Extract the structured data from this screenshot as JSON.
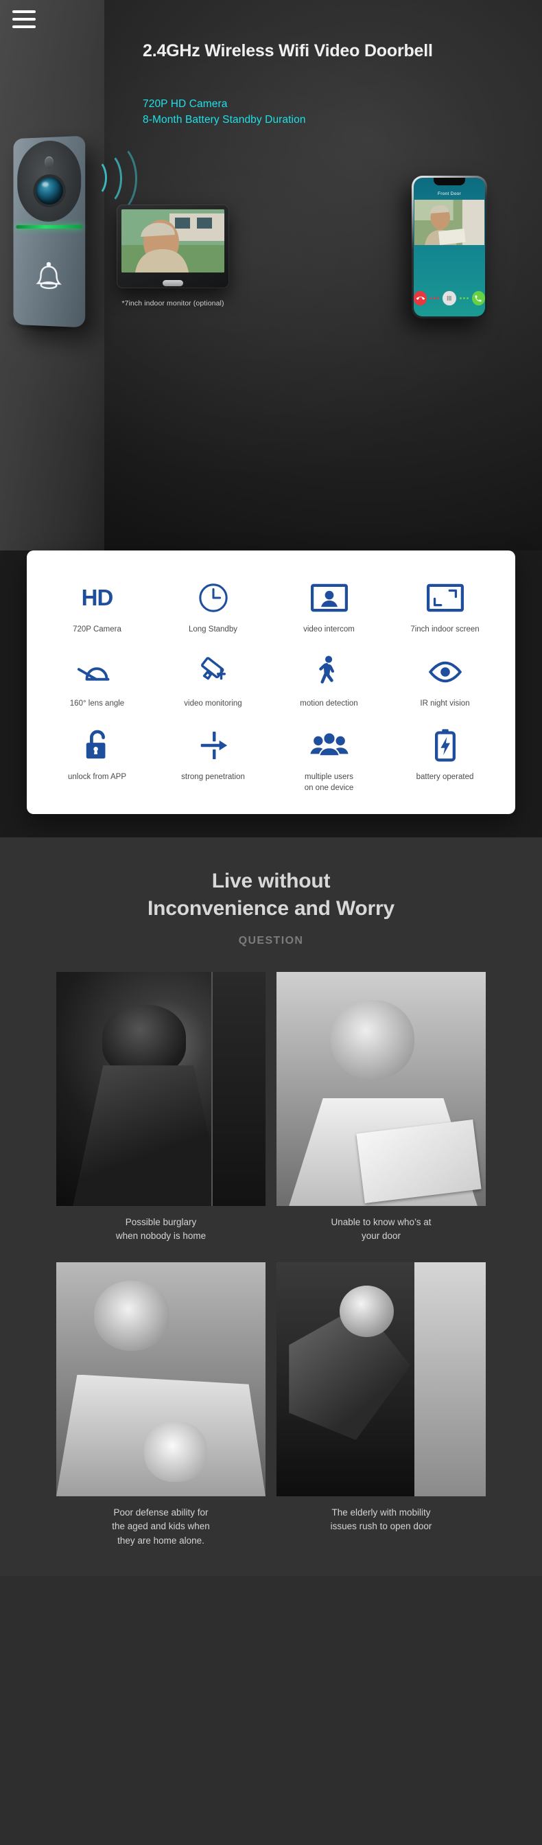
{
  "hero": {
    "menu_icon": "hamburger-menu-icon",
    "title": "2.4GHz Wireless\nWifi Video Doorbell",
    "highlight_1": "720P HD Camera",
    "highlight_2": "8-Month Battery Standby Duration",
    "monitor_caption": "*7inch indoor monitor (optional)",
    "phone": {
      "screen_title": "Front Door",
      "decline_icon": "phone-decline-icon",
      "mute_icon": "speaker-mute-icon",
      "answer_icon": "phone-answer-icon"
    },
    "colors": {
      "accent_cyan": "#1fe0e8",
      "led_green": "#27e06a",
      "decline_red": "#e8383f",
      "answer_green": "#66d143"
    }
  },
  "features": {
    "accent_blue": "#1f4f9c",
    "items": [
      {
        "icon": "hd-text-icon",
        "label": "720P Camera"
      },
      {
        "icon": "clock-icon",
        "label": "Long Standby"
      },
      {
        "icon": "person-in-frame-icon",
        "label": "video intercom"
      },
      {
        "icon": "screen-corners-icon",
        "label": "7inch indoor screen"
      },
      {
        "icon": "lens-angle-icon",
        "label": "160° lens angle"
      },
      {
        "icon": "cctv-camera-icon",
        "label": "video monitoring"
      },
      {
        "icon": "walking-person-icon",
        "label": "motion detection"
      },
      {
        "icon": "eye-icon",
        "label": "IR night vision"
      },
      {
        "icon": "open-padlock-icon",
        "label": "unlock from APP"
      },
      {
        "icon": "arrow-through-wall-icon",
        "label": "strong penetration"
      },
      {
        "icon": "group-users-icon",
        "label": "multiple users\non one device"
      },
      {
        "icon": "battery-bolt-icon",
        "label": "battery operated"
      }
    ]
  },
  "question_section": {
    "title": "Live without\nInconvenience and Worry",
    "kicker": "QUESTION",
    "cards": [
      {
        "image": "burglar-at-door-photo",
        "caption": "Possible burglary\nwhen nobody is home"
      },
      {
        "image": "courier-with-parcel-photo",
        "caption": "Unable to know who’s at\nyour door"
      },
      {
        "image": "elderly-man-with-baby-photo",
        "caption": "Poor defense ability for\nthe aged and kids when\nthey are home alone."
      },
      {
        "image": "hand-opening-door-photo",
        "caption": "The elderly with mobility\nissues rush to open door"
      }
    ]
  }
}
